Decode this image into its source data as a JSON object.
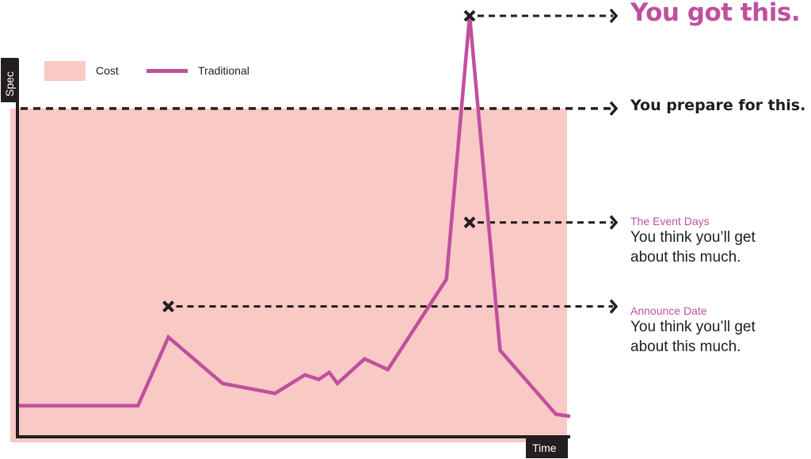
{
  "chart_data": {
    "type": "line",
    "title": "",
    "xlabel": "Time",
    "ylabel": "Spec",
    "xlim": [
      0,
      100
    ],
    "ylim": [
      0,
      100
    ],
    "grid": false,
    "legend": {
      "placement": "top-left",
      "entries": [
        {
          "name": "Cost",
          "kind": "area",
          "color": "#f9c9c6"
        },
        {
          "name": "Traditional",
          "kind": "line",
          "color": "#c0509e"
        }
      ]
    },
    "series": [
      {
        "name": "Traditional",
        "color": "#c0509e",
        "x": [
          0,
          21.8,
          27.3,
          37.1,
          46.6,
          52.0,
          54.5,
          56.4,
          57.9,
          62.8,
          67.0,
          77.6,
          81.8,
          87.3,
          97.4,
          100
        ],
        "y": [
          4.9,
          4.9,
          21.6,
          10.3,
          7.9,
          12.4,
          11.3,
          13.0,
          10.3,
          16.3,
          13.7,
          35.7,
          100,
          18.4,
          2.8,
          2.3
        ]
      }
    ],
    "areas": [
      {
        "name": "Cost",
        "color": "#f9c9c6",
        "y_top": 77.4
      }
    ],
    "annotations": [
      {
        "id": "peak",
        "marker": "x",
        "x": 81.8,
        "y": 100,
        "title": "",
        "text": "You got this.",
        "style": "large-accent"
      },
      {
        "id": "prepare",
        "marker": "none",
        "y": 77.4,
        "title": "",
        "text": "You prepare for this.",
        "style": "bold"
      },
      {
        "id": "event-days",
        "marker": "x",
        "x": 81.8,
        "y": 49.6,
        "title": "The Event Days",
        "text": [
          "You think you’ll get",
          "about this much."
        ],
        "style": "normal"
      },
      {
        "id": "announce",
        "marker": "x",
        "x": 27.3,
        "y": 29.1,
        "title": "Announce Date",
        "text": [
          "You think you’ll get",
          "about this much."
        ],
        "style": "normal"
      }
    ]
  },
  "colors": {
    "accent": "#c0509e",
    "cost_fill": "#f9c9c6",
    "axis": "#231f20",
    "text": "#1e1e1e"
  }
}
